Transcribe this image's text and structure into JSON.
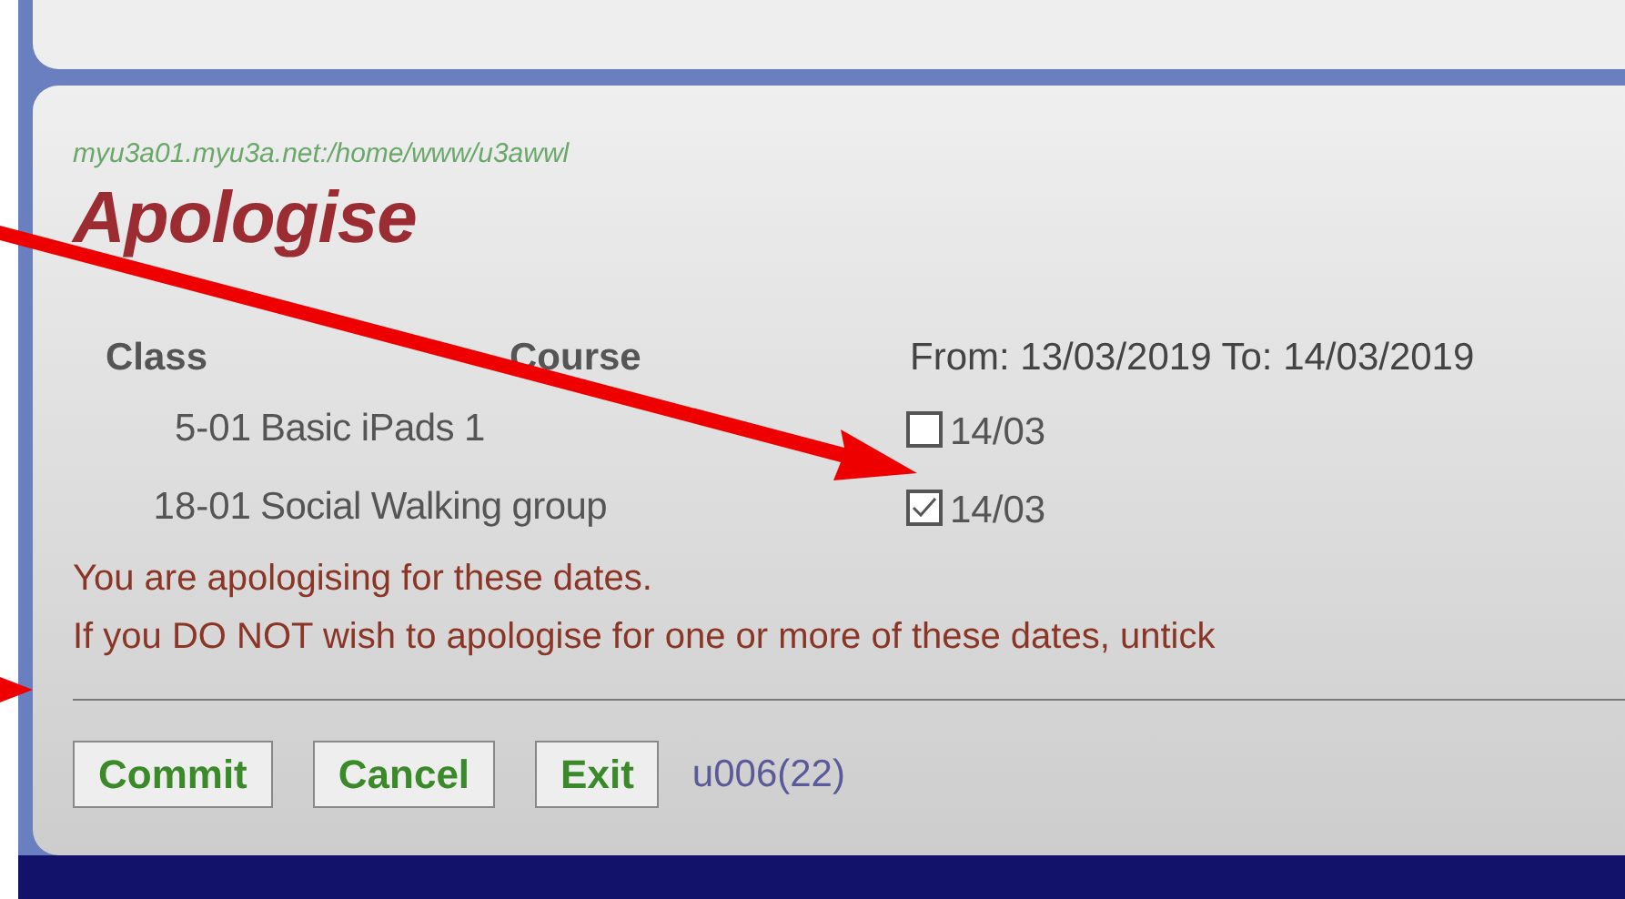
{
  "path": "myu3a01.myu3a.net:/home/www/u3awwl",
  "title": "Apologise",
  "columns": [
    "Class",
    "Course"
  ],
  "date_range": "From: 13/03/2019 To: 14/03/2019",
  "rows": [
    {
      "class": "5-01",
      "course": "Basic iPads 1",
      "checked": false,
      "date": "14/03"
    },
    {
      "class": "18-01",
      "course": "Social Walking group",
      "checked": true,
      "date": "14/03"
    }
  ],
  "messages": [
    "You are apologising for these dates.",
    "If you DO NOT wish to apologise for one or more of these dates, untick"
  ],
  "buttons": [
    "Commit",
    "Cancel",
    "Exit"
  ],
  "user_code": "u006(22)"
}
